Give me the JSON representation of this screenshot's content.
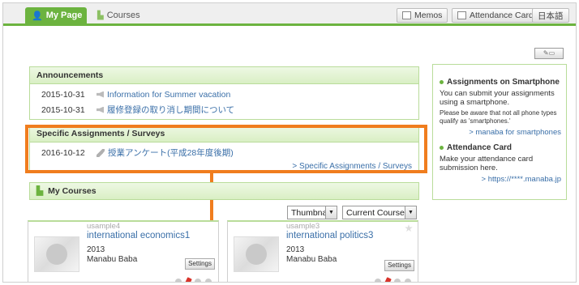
{
  "nav": {
    "my_page": "My Page",
    "courses": "Courses",
    "memos": "Memos",
    "attendance_card": "Attendance Card",
    "language": "日本語"
  },
  "announcements": {
    "header": "Announcements",
    "items": [
      {
        "date": "2015-10-31",
        "title": "Information for Summer vacation"
      },
      {
        "date": "2015-10-31",
        "title": "履修登録の取り消し期間について"
      }
    ]
  },
  "assignments": {
    "header": "Specific Assignments / Surveys",
    "items": [
      {
        "date": "2016-10-12",
        "title": "授業アンケート(平成28年度後期)"
      }
    ],
    "more_link": "Specific Assignments / Surveys"
  },
  "my_courses": {
    "header": "My Courses",
    "view_select": "Thumbnail",
    "filter_select": "Current Courses",
    "cards": [
      {
        "code": "usample4",
        "name": "international economics1",
        "year": "2013",
        "teacher": "Manabu Baba",
        "settings_label": "Settings"
      },
      {
        "code": "usample3",
        "name": "international politics3",
        "year": "2013",
        "teacher": "Manabu Baba",
        "settings_label": "Settings"
      }
    ]
  },
  "sidebar": {
    "smartphone_title": "Assignments on Smartphone",
    "smartphone_text": "You can submit your assignments using a smartphone.",
    "smartphone_note": "Please be aware that not all phone types qualify as 'smartphones.'",
    "smartphone_link": "manaba for smartphones",
    "attendance_title": "Attendance Card",
    "attendance_text": "Make your attendance card submission here.",
    "attendance_link": "https://****.manaba.jp"
  },
  "colors": {
    "accent_green": "#6cb33f",
    "highlight_orange": "#f07d1e",
    "link_blue": "#3a6fa8"
  }
}
